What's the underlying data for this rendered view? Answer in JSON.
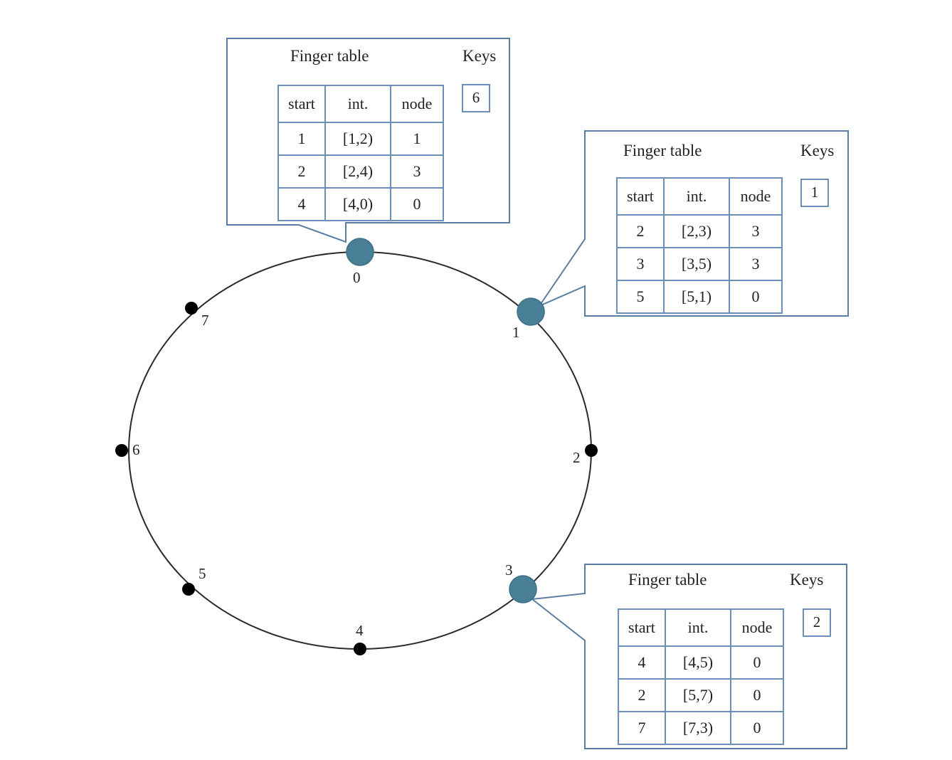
{
  "diagram": {
    "type": "chord-ring",
    "ring_positions": [
      {
        "id": 0,
        "label": "0",
        "active": true
      },
      {
        "id": 1,
        "label": "1",
        "active": true
      },
      {
        "id": 2,
        "label": "2",
        "active": false
      },
      {
        "id": 3,
        "label": "3",
        "active": true
      },
      {
        "id": 4,
        "label": "4",
        "active": false
      },
      {
        "id": 5,
        "label": "5",
        "active": false
      },
      {
        "id": 6,
        "label": "6",
        "active": false
      },
      {
        "id": 7,
        "label": "7",
        "active": false
      }
    ],
    "colors": {
      "active_node": "#4a7f98",
      "inactive_node": "#000000",
      "callout_border": "#5a7da3",
      "table_border": "#6b8fb8"
    }
  },
  "panels": [
    {
      "node": "0",
      "title": "Finger table",
      "keys_title": "Keys",
      "keys": [
        "6"
      ],
      "headers": [
        "start",
        "int.",
        "node"
      ],
      "rows": [
        [
          "1",
          "[1,2)",
          "1"
        ],
        [
          "2",
          "[2,4)",
          "3"
        ],
        [
          "4",
          "[4,0)",
          "0"
        ]
      ]
    },
    {
      "node": "1",
      "title": "Finger table",
      "keys_title": "Keys",
      "keys": [
        "1"
      ],
      "headers": [
        "start",
        "int.",
        "node"
      ],
      "rows": [
        [
          "2",
          "[2,3)",
          "3"
        ],
        [
          "3",
          "[3,5)",
          "3"
        ],
        [
          "5",
          "[5,1)",
          "0"
        ]
      ]
    },
    {
      "node": "3",
      "title": "Finger table",
      "keys_title": "Keys",
      "keys": [
        "2"
      ],
      "headers": [
        "start",
        "int.",
        "node"
      ],
      "rows": [
        [
          "4",
          "[4,5)",
          "0"
        ],
        [
          "2",
          "[5,7)",
          "0"
        ],
        [
          "7",
          "[7,3)",
          "0"
        ]
      ]
    }
  ]
}
